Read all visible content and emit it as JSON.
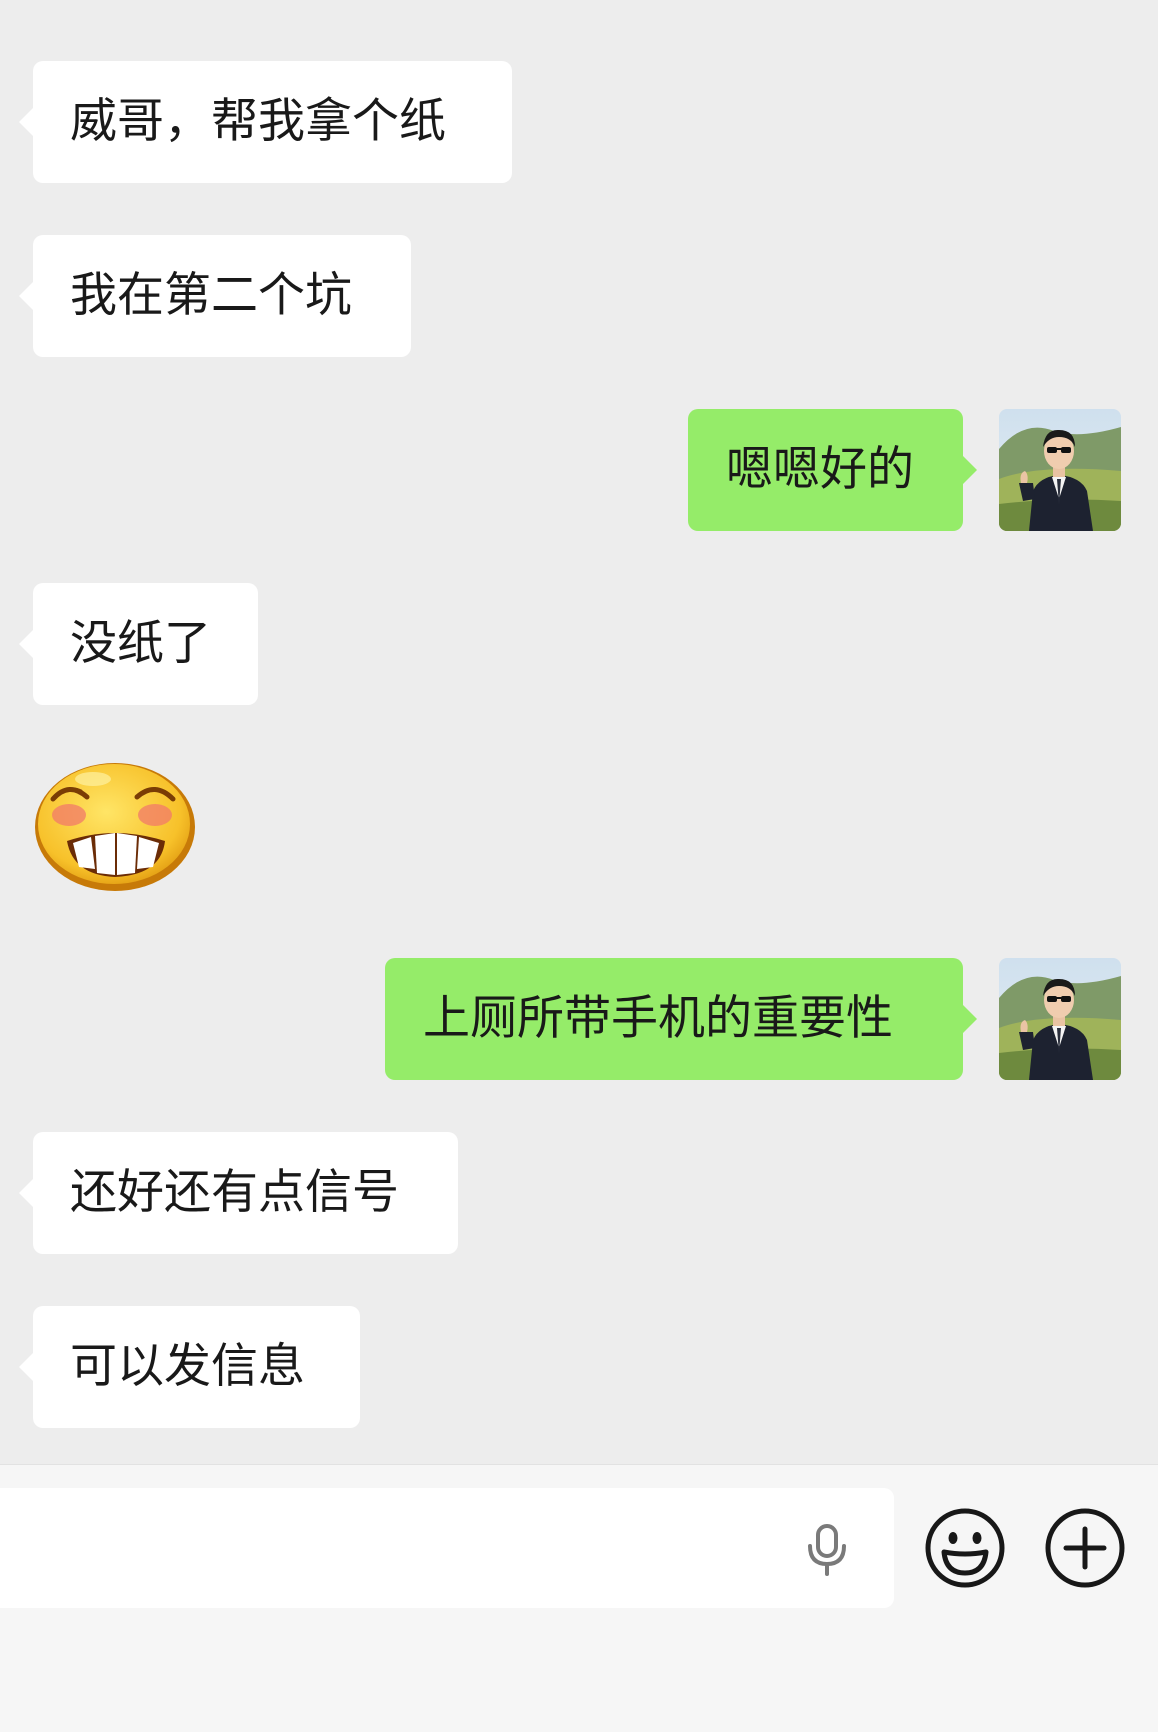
{
  "messages": [
    {
      "id": "m1",
      "direction": "incoming",
      "text": "威哥，帮我拿个纸"
    },
    {
      "id": "m2",
      "direction": "incoming",
      "text": "我在第二个坑"
    },
    {
      "id": "m3",
      "direction": "outgoing",
      "text": "嗯嗯好的"
    },
    {
      "id": "m4",
      "direction": "incoming",
      "text": "没纸了"
    },
    {
      "id": "m5",
      "direction": "incoming",
      "sticker": "grinning-blushing-face-sticker"
    },
    {
      "id": "m6",
      "direction": "outgoing",
      "text": "上厕所带手机的重要性"
    },
    {
      "id": "m7",
      "direction": "incoming",
      "text": "还好还有点信号"
    },
    {
      "id": "m8",
      "direction": "incoming",
      "text": "可以发信息"
    }
  ],
  "input_bar": {
    "text_value": "",
    "voice_icon": "microphone-icon",
    "emoji_icon": "smiley-face-icon",
    "more_icon": "plus-circle-icon"
  },
  "colors": {
    "chat_background": "#ededed",
    "incoming_bubble": "#ffffff",
    "outgoing_bubble": "#95ec69",
    "text": "#191919",
    "input_bar_background": "#f6f6f6"
  }
}
